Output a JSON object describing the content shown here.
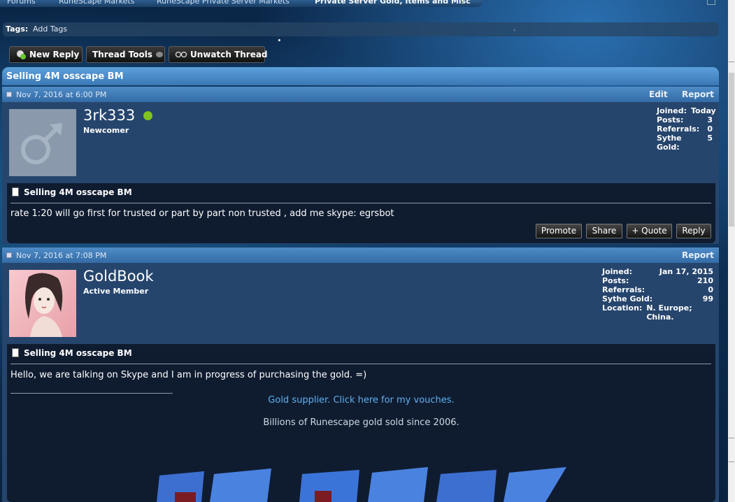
{
  "breadcrumb": [
    "Forums",
    "RuneScape Markets",
    "RuneScape Private Server Markets",
    "Private Server Gold, Items and Misc"
  ],
  "tags": {
    "label": "Tags:",
    "value": "Add Tags"
  },
  "thread_buttons": {
    "new_reply": "New Reply",
    "thread_tools": "Thread Tools",
    "unwatch": "Unwatch Thread"
  },
  "thread_title": "Selling 4M osscape BM",
  "posts": [
    {
      "date": "Nov 7, 2016 at 6:00 PM",
      "edit_label": "Edit",
      "report_label": "Report",
      "username": "3rk333",
      "rank": "Newcomer",
      "online": true,
      "stats": [
        {
          "k": "Joined:",
          "v": "Today"
        },
        {
          "k": "Posts:",
          "v": "3"
        },
        {
          "k": "Referrals:",
          "v": "0"
        },
        {
          "k": "Sythe Gold:",
          "v": "5"
        }
      ],
      "message_title": "Selling 4M osscape BM",
      "message_text": "rate 1:20 will go first for trusted or part by part non trusted , add me skype: egrsbot",
      "actions": [
        "Promote",
        "Share",
        "+ Quote",
        "Reply"
      ]
    },
    {
      "date": "Nov 7, 2016 at 7:08 PM",
      "report_label": "Report",
      "username": "GoldBook",
      "rank": "Active Member",
      "stats": [
        {
          "k": "Joined:",
          "v": "Jan 17, 2015"
        },
        {
          "k": "Posts:",
          "v": "210"
        },
        {
          "k": "Referrals:",
          "v": "0"
        },
        {
          "k": "Sythe Gold:",
          "v": "99"
        },
        {
          "k": "Location:",
          "v": "N. Europe; China."
        }
      ],
      "message_title": "Selling 4M osscape BM",
      "message_text": "Hello, we are talking on Skype and I am in progress of purchasing the gold. =)",
      "signature_link": "Gold supplier. Click here for my vouches.",
      "signature_line": "Billions of Runescape gold sold since 2006."
    }
  ],
  "colors": {
    "link": "#5fb0f0",
    "online": "#7fc41d",
    "header": "#3a78b5"
  }
}
